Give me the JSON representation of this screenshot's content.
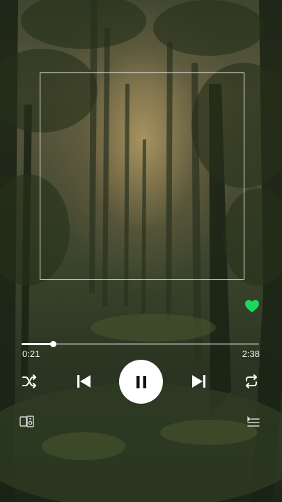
{
  "player": {
    "liked": true,
    "progress": {
      "elapsed": "0:21",
      "total": "2:38",
      "fraction": 0.133
    },
    "state": "playing"
  },
  "colors": {
    "like_active": "#1ed760",
    "control_fg": "#ffffff",
    "play_button_bg": "#ffffff",
    "play_button_icon": "#111111"
  },
  "icons": {
    "like": "heart-icon",
    "shuffle": "shuffle-icon",
    "previous": "skip-previous-icon",
    "play_pause": "pause-icon",
    "next": "skip-next-icon",
    "repeat": "repeat-icon",
    "devices": "devices-icon",
    "queue": "queue-icon"
  }
}
